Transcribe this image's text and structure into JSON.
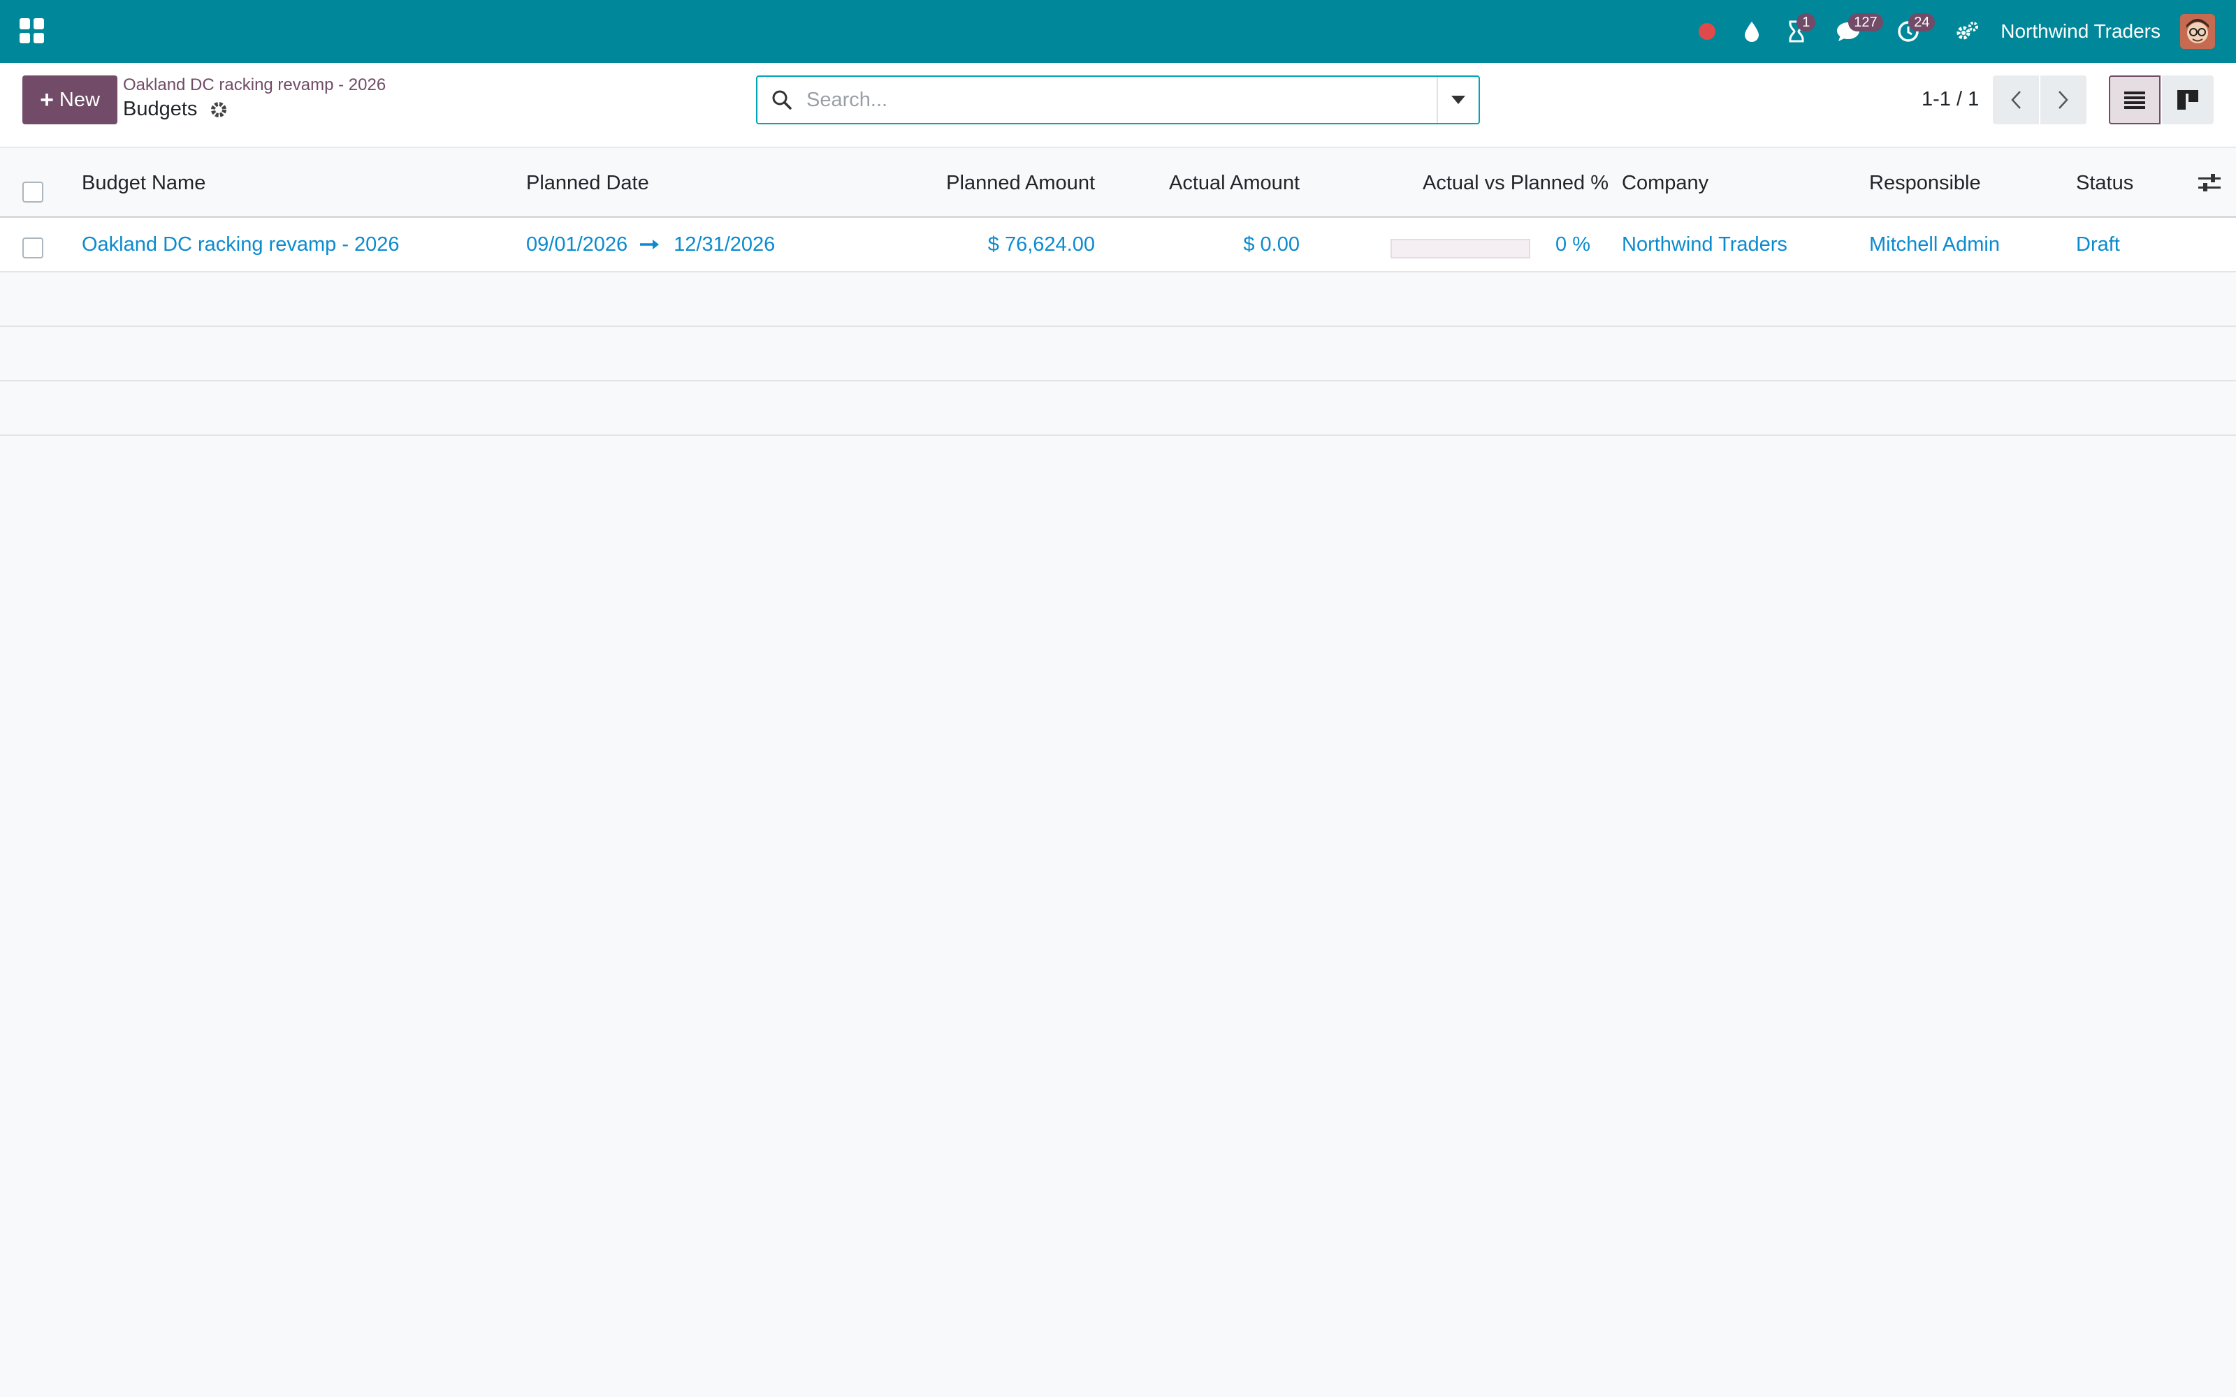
{
  "navbar": {
    "company": "Northwind Traders",
    "activity_badge": "1",
    "messages_badge": "127",
    "clock_badge": "24",
    "colors": {
      "bg": "#00889a",
      "badge": "#714b67",
      "record": "#e04a4a"
    }
  },
  "control_panel": {
    "new_label": "New",
    "breadcrumb_parent": "Oakland DC racking revamp - 2026",
    "breadcrumb_current": "Budgets",
    "search_placeholder": "Search...",
    "search_value": "",
    "pager": "1-1 / 1"
  },
  "table": {
    "columns": {
      "name": "Budget Name",
      "date": "Planned Date",
      "planned": "Planned Amount",
      "actual": "Actual Amount",
      "ratio": "Actual vs Planned %",
      "company": "Company",
      "responsible": "Responsible",
      "status": "Status"
    },
    "rows": [
      {
        "name": "Oakland DC racking revamp - 2026",
        "date_from": "09/01/2026",
        "date_to": "12/31/2026",
        "planned": "$ 76,624.00",
        "actual": "$ 0.00",
        "ratio_text": "0 %",
        "ratio_value": 0,
        "company": "Northwind Traders",
        "responsible": "Mitchell Admin",
        "status": "Draft"
      }
    ]
  }
}
